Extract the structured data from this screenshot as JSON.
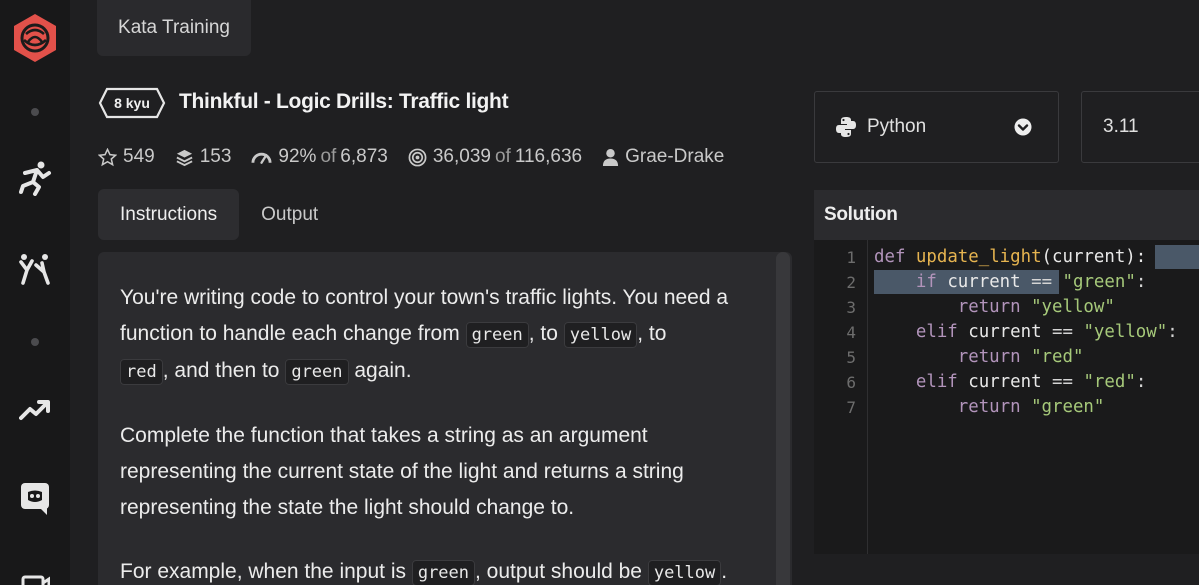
{
  "app": {
    "section_tab": "Kata Training"
  },
  "kata": {
    "rank": "8 kyu",
    "title": "Thinkful - Logic Drills: Traffic light",
    "stats": {
      "stars": "549",
      "collections": "153",
      "satisfaction_pct": "92%",
      "satisfaction_of": "of",
      "satisfaction_total": "6,873",
      "completed": "36,039",
      "completed_of": "of",
      "completed_total": "116,636",
      "author": "Grae-Drake"
    }
  },
  "tabs": [
    {
      "label": "Instructions"
    },
    {
      "label": "Output"
    }
  ],
  "instructions": {
    "p1_a": "You're writing code to control your town's traffic lights. You need a function to handle each change from ",
    "p1_code1": "green",
    "p1_b": ", to ",
    "p1_code2": "yellow",
    "p1_c": ", to ",
    "p1_code3": "red",
    "p1_d": ", and then to ",
    "p1_code4": "green",
    "p1_e": " again.",
    "p2": "Complete the function that takes a string as an argument representing the current state of the light and returns a string representing the state the light should change to.",
    "p3_a": "For example, when the input is ",
    "p3_code1": "green",
    "p3_b": ", output should be ",
    "p3_code2": "yellow",
    "p3_c": "."
  },
  "editor": {
    "language": "Python",
    "version": "3.11",
    "panel_title": "Solution",
    "line_numbers": [
      "1",
      "2",
      "3",
      "4",
      "5",
      "6",
      "7"
    ],
    "lines": [
      {
        "indent": "",
        "kw": "def",
        "fn": "update_light",
        "rest": "(current):"
      },
      {
        "indent": "    ",
        "kw": "if",
        "var": "current",
        "op": " == ",
        "str": "\"green\"",
        "end": ":"
      },
      {
        "indent": "        ",
        "kw": "return",
        "str": "\"yellow\""
      },
      {
        "indent": "    ",
        "kw": "elif",
        "var": "current",
        "op": " == ",
        "str": "\"yellow\"",
        "end": ":"
      },
      {
        "indent": "        ",
        "kw": "return",
        "str": "\"red\""
      },
      {
        "indent": "    ",
        "kw": "elif",
        "var": "current",
        "op": " == ",
        "str": "\"red\"",
        "end": ":"
      },
      {
        "indent": "        ",
        "kw": "return",
        "str": "\"green\""
      }
    ]
  },
  "icons": {
    "logo": "codewars-logo-icon",
    "run": "training-icon",
    "kick": "dojo-icon",
    "trend": "leaderboard-icon",
    "discord": "discord-icon",
    "star": "star-icon",
    "collections": "stack-icon",
    "satisfaction": "speedometer-icon",
    "completed": "target-icon",
    "author": "user-icon",
    "python": "python-icon",
    "chevron": "chevron-down-icon"
  },
  "colors": {
    "brand": "#e2514a",
    "background": "#1f1f21",
    "panel": "#2b2b2e",
    "keyword": "#b294bb",
    "function": "#e6b450",
    "string": "#a6c97a"
  }
}
